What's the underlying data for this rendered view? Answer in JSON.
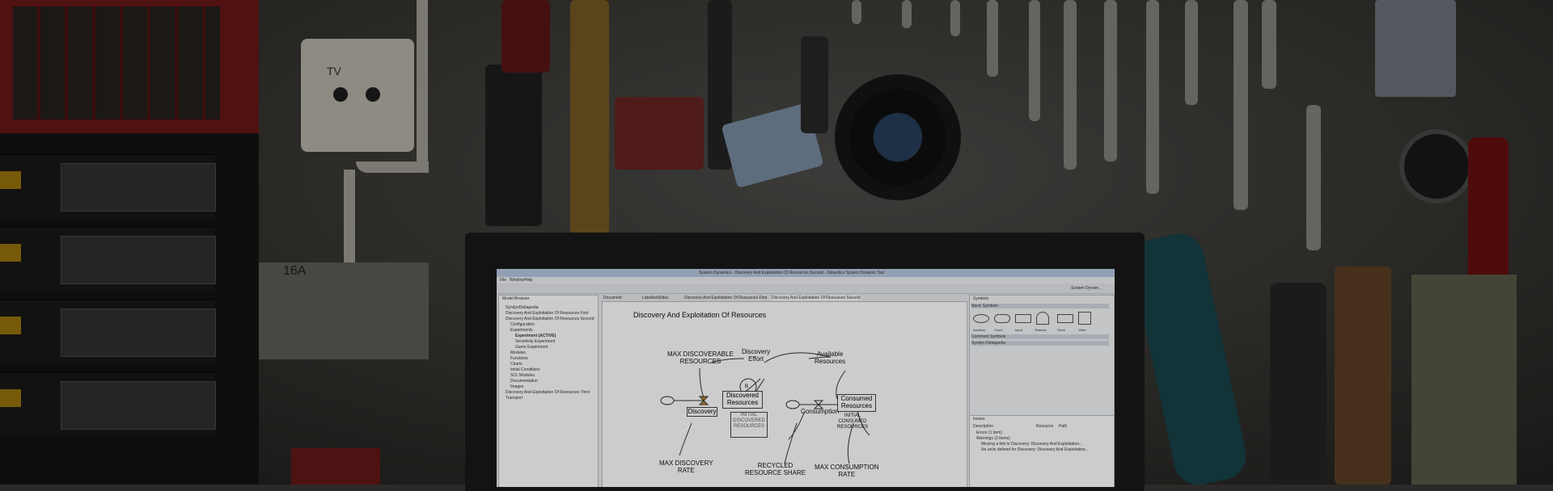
{
  "outlet": {
    "label": "TV"
  },
  "shelf_label": "16A",
  "window": {
    "title": "System Dynamics - Discovery And Exploitation Of Resources Second - Simantics System Dynamic Tool",
    "menu": [
      "File",
      "Window",
      "Help"
    ],
    "perspective": "System Dynam...",
    "tabs": [
      "Document",
      "LabelledSlides",
      "Discovery And Exploitation Of Resources First",
      "Discovery And Exploitation Of Resources Second"
    ]
  },
  "sidebar": {
    "header": "Model Browser",
    "items": [
      "SyndynDeltapedia",
      "Discovery And Exploitation Of Resources First",
      "Discovery And Exploitation Of Resources Second",
      "Configuration",
      "Experiments",
      "Experiment (ACTIVE)",
      "Sensitivity Experiment",
      "Game Experiment",
      "Modules",
      "Functions",
      "Charts",
      "Initial Conditions",
      "SCL Modules",
      "Documentation",
      "Images",
      "Discovery And Exploitation Of Resources Third",
      "Transport"
    ]
  },
  "diagram": {
    "title": "Discovery And Exploitation Of Resources",
    "nodes": {
      "max_discoverable": "MAX DISCOVERABLE\nRESOURCES",
      "discovery_effort": "Discovery\nEffort",
      "available_resources": "Available\nResources",
      "loop": "B",
      "discovery": "Discovery",
      "discovered_resources": "Discovered\nResources",
      "initial_discovered": "INITIAL\nDISCOVERED\nRESOURCES",
      "consumption": "Consumption",
      "consumed_resources": "Consumed\nResources",
      "initial_consumed": "INITIAL\nCONSUMED\nRESOURCES",
      "max_discovery_rate": "MAX DISCOVERY\nRATE",
      "recycled_share": "RECYCLED\nRESOURCE SHARE",
      "max_consumption_rate": "MAX CONSUMPTION\nRATE"
    }
  },
  "right_panel": {
    "symbols_header": "Symbols",
    "palette_header": "Basic Symbols",
    "symbol_labels": [
      "Auxiliary",
      "Cloud",
      "Input",
      "Shadow",
      "Stock",
      "Valve"
    ],
    "section2": "Comment Symbols",
    "section3": "Syndyn Deltapedia",
    "issues_header": "Issues",
    "issues_cols": [
      "Description",
      "Resource",
      "Path"
    ],
    "issues": [
      "Errors (1 item)",
      "Warnings (2 items)",
      "Missing a link to Discovery: Discovery And Exploitation...",
      "No units defined for Discovery: Discovery And Exploitation..."
    ]
  },
  "colors": {
    "wall": "#4a4945",
    "screen": "#e9ebee",
    "accent": "#b7c9e0"
  }
}
